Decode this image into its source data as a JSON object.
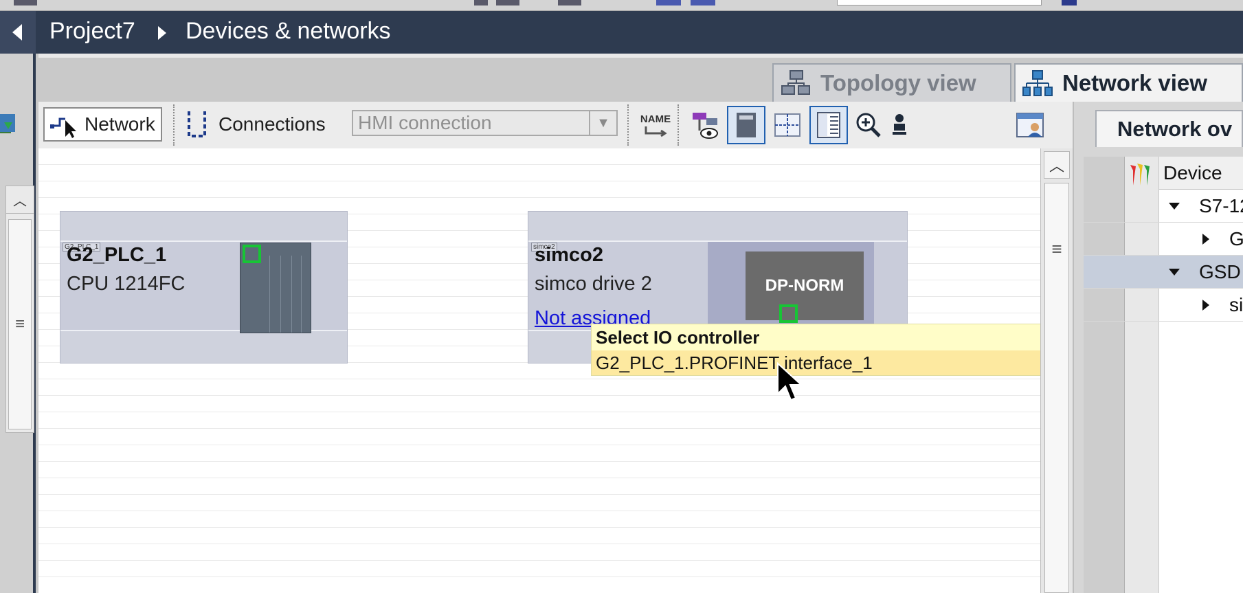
{
  "breadcrumb": {
    "project": "Project7",
    "page": "Devices & networks"
  },
  "view_tabs": [
    {
      "label": "Topology view",
      "active": false
    },
    {
      "label": "Network view",
      "active": true
    }
  ],
  "toolbar": {
    "network_label": "Network",
    "connections_label": "Connections",
    "connection_type_value": "HMI connection",
    "name_icon_text": "NAME"
  },
  "devices": [
    {
      "small_label": "G2_PLC_1",
      "name": "G2_PLC_1",
      "type": "CPU 1214FC"
    },
    {
      "small_label": "simco2",
      "name": "simco2",
      "type": "simco drive 2",
      "link": "Not assigned",
      "module_text": "DP-NORM"
    }
  ],
  "tooltip": {
    "title": "Select IO controller",
    "item": "G2_PLC_1.PROFINET interface_1"
  },
  "network_overview": {
    "tab_label": "Network ov",
    "column_header": "Device",
    "rows": [
      {
        "label": "S7-12"
      },
      {
        "label": "G"
      },
      {
        "label": "GSD"
      },
      {
        "label": "si"
      }
    ]
  },
  "colors": {
    "header_bg": "#2e3b50",
    "port_green": "#17c535",
    "tooltip_bg": "#fffdc8",
    "link_blue": "#1313d8"
  }
}
